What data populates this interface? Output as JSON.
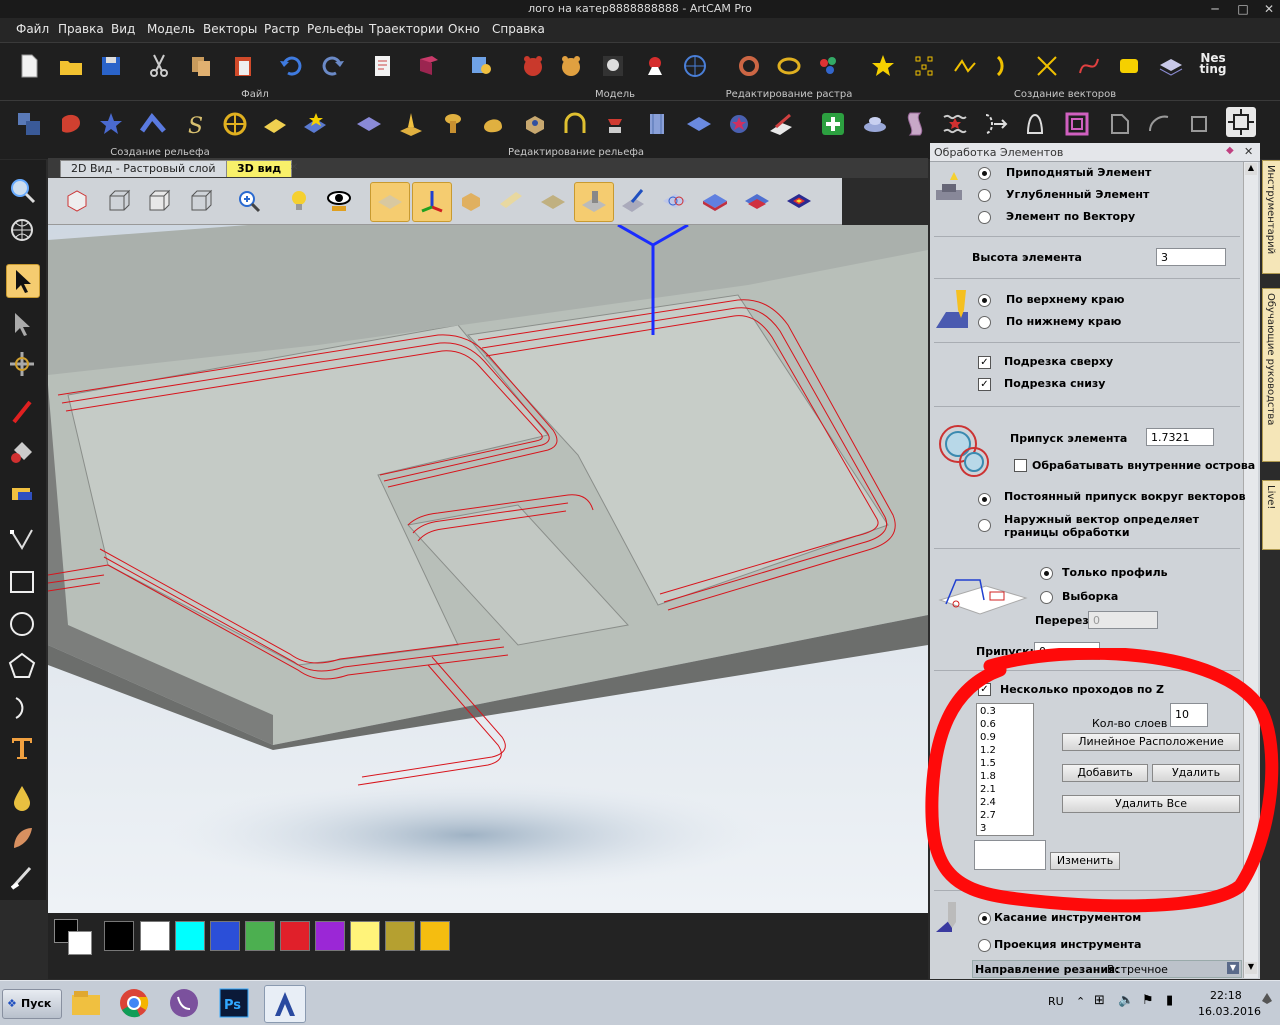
{
  "window": {
    "title": "лого на катер8888888888 - ArtCAM Pro",
    "min": "─",
    "max": "□",
    "close": "✕"
  },
  "menu": [
    "Файл",
    "Правка",
    "Вид",
    "Модель",
    "Векторы",
    "Растр",
    "Рельефы",
    "Траектории",
    "Окно",
    "Справка"
  ],
  "toolbar_groups": {
    "row1": [
      "Файл",
      "Модель",
      "Редактирование растра",
      "Создание векторов"
    ],
    "row2": [
      "Создание рельефа",
      "Редактирование рельефа"
    ]
  },
  "nesting_label": "Nes ting",
  "tabs": [
    {
      "label": "2D Вид - Растровый слой",
      "active": false
    },
    {
      "label": "3D вид",
      "active": true
    }
  ],
  "palette": {
    "colors": [
      "#000000",
      "#ffffff",
      "#00ffff",
      "#2b4fd8",
      "#4caf50",
      "#e0202a",
      "#9b27d6",
      "#fff37a",
      "#b5a030",
      "#f5bd10"
    ]
  },
  "panel": {
    "title": "Обработка Элементов",
    "element_type": {
      "options": [
        "Приподнятый Элемент",
        "Углубленный Элемент",
        "Элемент по Вектору"
      ],
      "selected": 0
    },
    "height_label": "Высота элемента",
    "height_value": "3",
    "edge": {
      "options": [
        "По верхнему краю",
        "По нижнему краю"
      ],
      "selected": 0
    },
    "trim_top": {
      "label": "Подрезка сверху",
      "checked": true
    },
    "trim_bottom": {
      "label": "Подрезка снизу",
      "checked": true
    },
    "allowance_label": "Припуск элемента",
    "allowance_value": "1.7321",
    "inner_islands": {
      "label": "Обрабатывать внутренние острова",
      "checked": false
    },
    "boundary": {
      "options": [
        "Постоянный припуск вокруг векторов",
        "Наружный вектор определяет границы обработки"
      ],
      "selected": 0
    },
    "profile": {
      "options": [
        "Только профиль",
        "Выборка"
      ],
      "selected": 0
    },
    "overlap_label": "Перерез",
    "overlap_value": "0",
    "stock_label": "Припуск:",
    "stock_value": "0",
    "multi_z": {
      "label": "Несколько проходов по Z",
      "checked": true
    },
    "layers": [
      "0.3",
      "0.6",
      "0.9",
      "1.2",
      "1.5",
      "1.8",
      "2.1",
      "2.4",
      "2.7",
      "3"
    ],
    "layer_count_label": "Кол-во слоев",
    "layer_count_value": "10",
    "btn_linear": "Линейное Расположение",
    "btn_add": "Добавить",
    "btn_delete": "Удалить",
    "btn_delete_all": "Удалить Все",
    "change_value": "",
    "btn_change": "Изменить",
    "tool": {
      "options": [
        "Касание инструментом",
        "Проекция инструмента"
      ],
      "selected": 0
    },
    "direction_label": "Направление резания:",
    "direction_value": "Встречное"
  },
  "sidetabs": [
    "Инструментарий",
    "Обучающие руководства",
    "Live!"
  ],
  "taskbar": {
    "start": "Пуск",
    "lang": "RU",
    "time": "22:18",
    "date": "16.03.2016"
  }
}
